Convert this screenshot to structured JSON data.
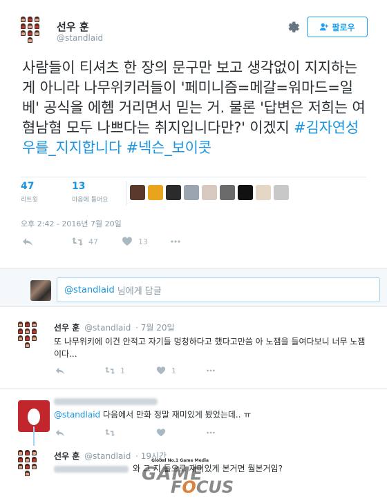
{
  "tweet": {
    "author_name": "선우 훈",
    "author_handle": "@standlaid",
    "follow_label": "팔로우",
    "text_plain": "사람들이 티셔츠 한 장의 문구만 보고 생각없이 지지하는게 아니라 나무위키러들이 '페미니즘=메갈=워마드=일베' 공식을 에헴 거리면서 믿는 거. 물론 '답변은 저희는 여혐남혐 모두 나쁘다는 취지입니다만?' 이겠지",
    "hashtags": [
      "#김자연성우를_지지합니다",
      "#넥슨_보이콧"
    ],
    "retweets_count": "47",
    "retweets_label": "리트윗",
    "likes_count": "13",
    "likes_label": "마음에 들어요",
    "timestamp": "오후 2:42 - 2016년 7월 20일",
    "action_retweet_count": "47",
    "action_like_count": "13",
    "liker_colors": [
      "#5a3a2a",
      "#e8a41c",
      "#2b2b2b",
      "#9aa5b0",
      "#d8c9c0",
      "#6b6b6b",
      "#111111",
      "#e6d6c6",
      "#c8c8c8"
    ]
  },
  "reply_box": {
    "mention": "@standlaid",
    "placeholder": "님에게 답글"
  },
  "replies": [
    {
      "name": "선우 훈",
      "handle": "@standlaid",
      "date": "· 7월 20일",
      "text": "또 나무위키에 이건 안적고 자기들 멍청하다고 했다고만씀 아 노잼을 들여다보니 너무 노잼이다...",
      "retweets": "1",
      "likes": "1"
    },
    {
      "mention": "@standlaid",
      "text": "다음에서 만화 정말 재미있게 봤었는데.. ㅠ"
    },
    {
      "name": "선우 훈",
      "handle": "@standlaid",
      "date": "· 19시간",
      "text": "와 그 지 들으로 재미있게 본거면 뭘본거임?"
    }
  ],
  "watermark": {
    "small": "Global No.1 Game Media",
    "line1": "GAME",
    "line2_pre": "F",
    "line2_o": "O",
    "line2_post": "CUS"
  }
}
